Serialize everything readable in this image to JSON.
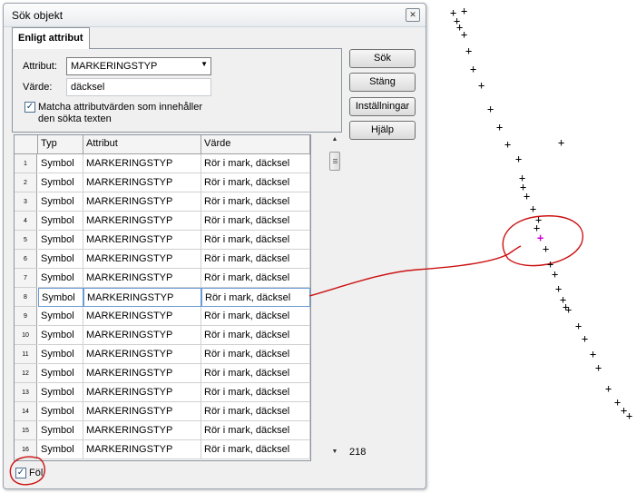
{
  "window": {
    "title": "Sök objekt"
  },
  "tab": {
    "label": "Enligt attribut"
  },
  "form": {
    "attribute_label": "Attribut:",
    "attribute_value": "MARKERINGSTYP",
    "value_label": "Värde:",
    "value_input": "däcksel",
    "match_checkbox_checked": true,
    "match_line1": "Matcha attributvärden som innehåller",
    "match_line2": "den sökta texten"
  },
  "buttons": {
    "search": "Sök",
    "close": "Stäng",
    "settings": "Inställningar",
    "help": "Hjälp"
  },
  "table": {
    "headers": [
      "Typ",
      "Attribut",
      "Värde"
    ],
    "rows": [
      {
        "n": "1",
        "typ": "Symbol",
        "attr": "MARKERINGSTYP",
        "val": "Rör i mark, däcksel"
      },
      {
        "n": "2",
        "typ": "Symbol",
        "attr": "MARKERINGSTYP",
        "val": "Rör i mark, däcksel"
      },
      {
        "n": "3",
        "typ": "Symbol",
        "attr": "MARKERINGSTYP",
        "val": "Rör i mark, däcksel"
      },
      {
        "n": "4",
        "typ": "Symbol",
        "attr": "MARKERINGSTYP",
        "val": "Rör i mark, däcksel"
      },
      {
        "n": "5",
        "typ": "Symbol",
        "attr": "MARKERINGSTYP",
        "val": "Rör i mark, däcksel"
      },
      {
        "n": "6",
        "typ": "Symbol",
        "attr": "MARKERINGSTYP",
        "val": "Rör i mark, däcksel"
      },
      {
        "n": "7",
        "typ": "Symbol",
        "attr": "MARKERINGSTYP",
        "val": "Rör i mark, däcksel"
      },
      {
        "n": "8",
        "typ": "Symbol",
        "attr": "MARKERINGSTYP",
        "val": "Rör i mark, däcksel",
        "selected": true
      },
      {
        "n": "9",
        "typ": "Symbol",
        "attr": "MARKERINGSTYP",
        "val": "Rör i mark, däcksel"
      },
      {
        "n": "10",
        "typ": "Symbol",
        "attr": "MARKERINGSTYP",
        "val": "Rör i mark, däcksel"
      },
      {
        "n": "11",
        "typ": "Symbol",
        "attr": "MARKERINGSTYP",
        "val": "Rör i mark, däcksel"
      },
      {
        "n": "12",
        "typ": "Symbol",
        "attr": "MARKERINGSTYP",
        "val": "Rör i mark, däcksel"
      },
      {
        "n": "13",
        "typ": "Symbol",
        "attr": "MARKERINGSTYP",
        "val": "Rör i mark, däcksel"
      },
      {
        "n": "14",
        "typ": "Symbol",
        "attr": "MARKERINGSTYP",
        "val": "Rör i mark, däcksel"
      },
      {
        "n": "15",
        "typ": "Symbol",
        "attr": "MARKERINGSTYP",
        "val": "Rör i mark, däcksel"
      },
      {
        "n": "16",
        "typ": "Symbol",
        "attr": "MARKERINGSTYP",
        "val": "Rör i mark, däcksel"
      }
    ]
  },
  "status": {
    "count": "218"
  },
  "footer": {
    "follow_label": "Föl",
    "follow_checked": true
  },
  "map": {
    "marker_glyph": "+",
    "highlight_color": "#d000d0",
    "annotation_color": "#cc1111"
  }
}
